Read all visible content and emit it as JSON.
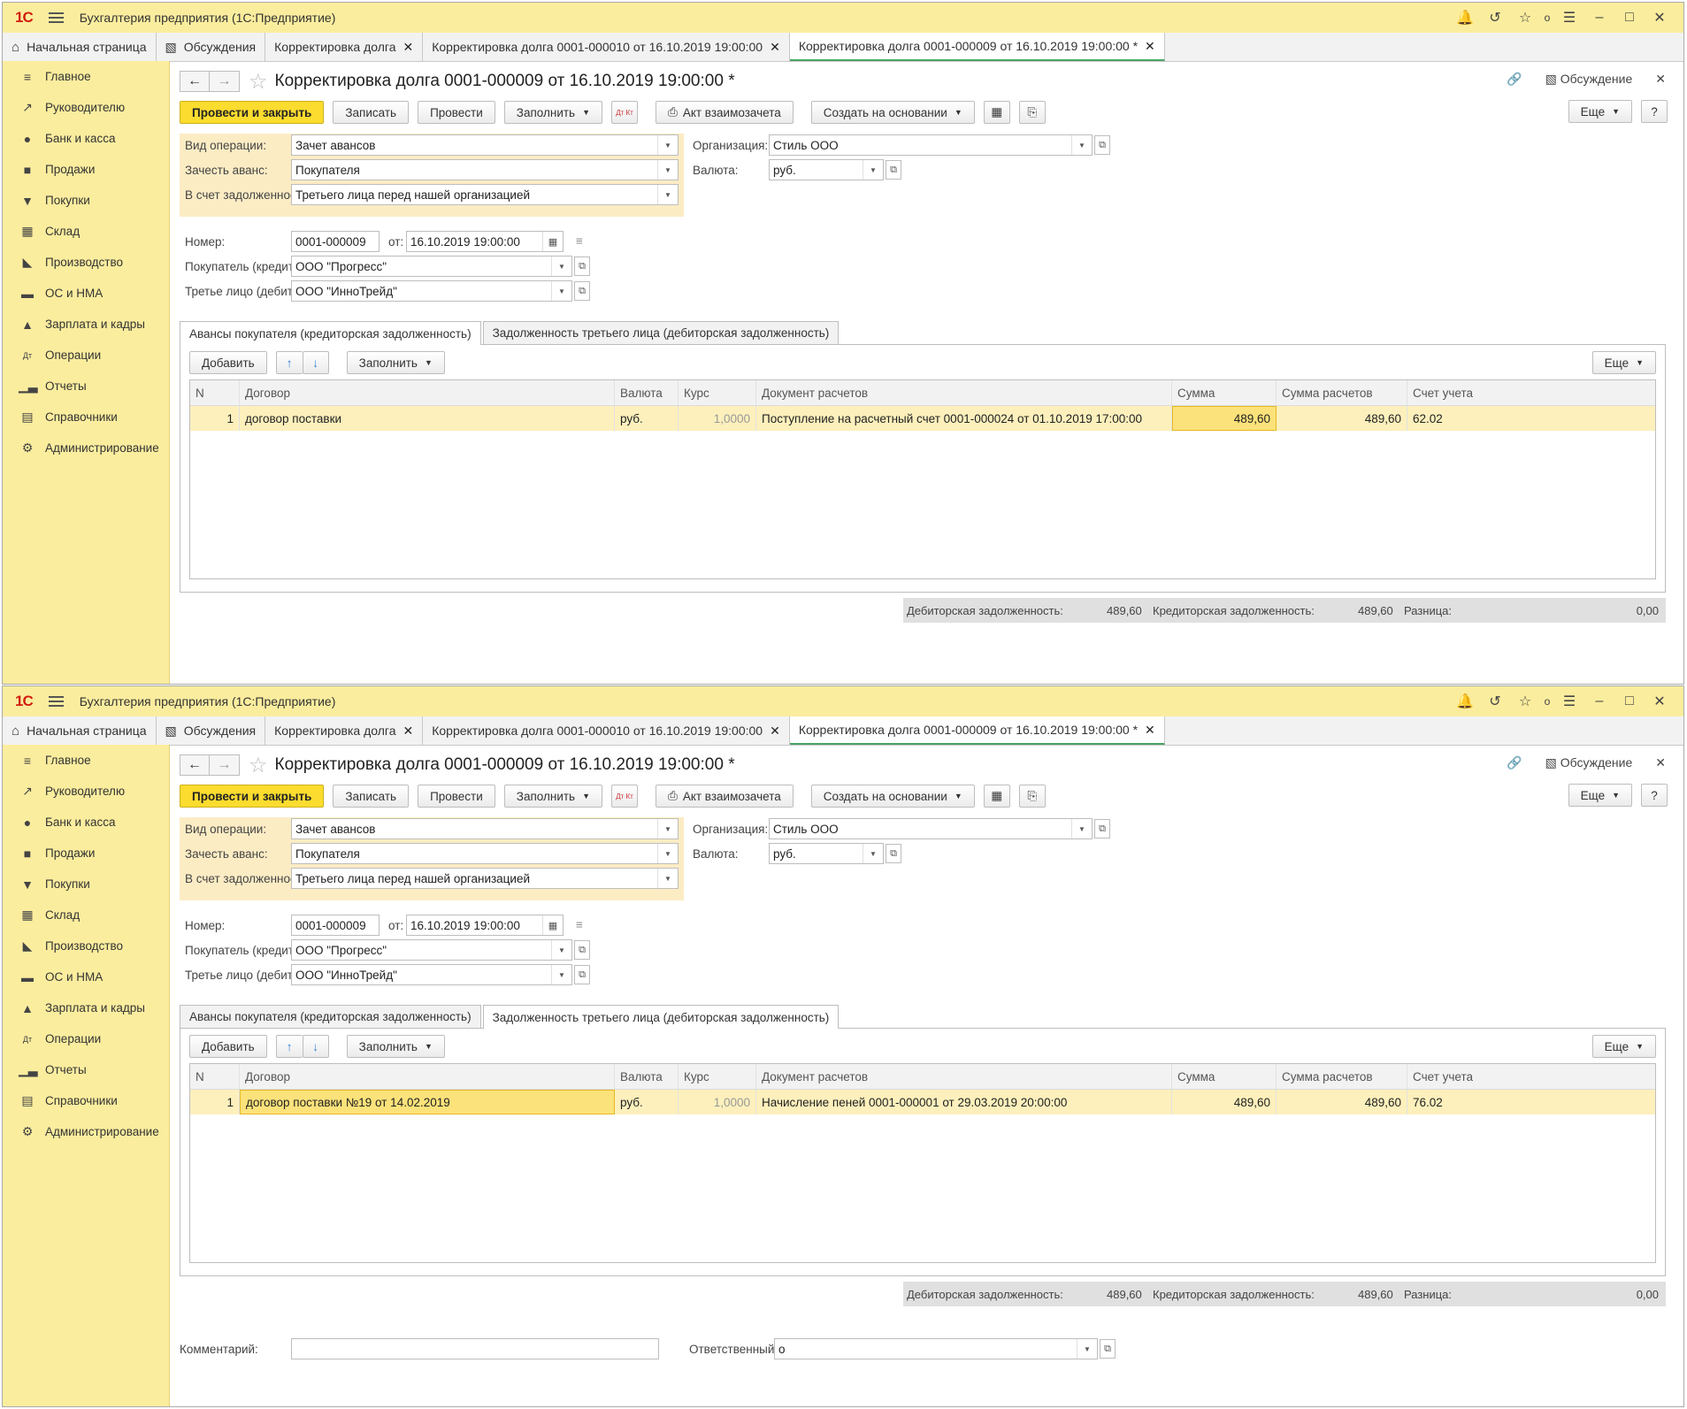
{
  "app": {
    "logo": "1С",
    "title": "Бухгалтерия предприятия  (1С:Предприятие)",
    "counter": "о"
  },
  "tabs": [
    {
      "label": "Начальная страница"
    },
    {
      "label": "Обсуждения"
    },
    {
      "label": "Корректировка долга"
    },
    {
      "label": "Корректировка долга 0001-000010 от 16.10.2019 19:00:00"
    },
    {
      "label": "Корректировка долга 0001-000009 от 16.10.2019 19:00:00 *"
    }
  ],
  "sidebar": [
    {
      "label": "Главное"
    },
    {
      "label": "Руководителю"
    },
    {
      "label": "Банк и касса"
    },
    {
      "label": "Продажи"
    },
    {
      "label": "Покупки"
    },
    {
      "label": "Склад"
    },
    {
      "label": "Производство"
    },
    {
      "label": "ОС и НМА"
    },
    {
      "label": "Зарплата и кадры"
    },
    {
      "label": "Операции"
    },
    {
      "label": "Отчеты"
    },
    {
      "label": "Справочники"
    },
    {
      "label": "Администрирование"
    }
  ],
  "doc": {
    "title": "Корректировка долга 0001-000009 от 16.10.2019 19:00:00 *",
    "discussion": "Обсуждение"
  },
  "toolbar": {
    "post_close": "Провести и закрыть",
    "save": "Записать",
    "post": "Провести",
    "fill": "Заполнить",
    "dtkt": "Дт Кт",
    "act": "Акт взаимозачета",
    "create_based": "Создать на основании",
    "more": "Еще",
    "help": "?"
  },
  "form": {
    "op_type_label": "Вид операции:",
    "op_type": "Зачет авансов",
    "advance_label": "Зачесть аванс:",
    "advance": "Покупателя",
    "debt_label": "В счет задолженности:",
    "debt": "Третьего лица перед нашей организацией",
    "org_label": "Организация:",
    "org": "Стиль ООО",
    "currency_label": "Валюта:",
    "currency": "руб.",
    "number_label": "Номер:",
    "number": "0001-000009",
    "from_label": "от:",
    "date": "16.10.2019 19:00:00",
    "buyer_label": "Покупатель (кредитор):",
    "buyer": "ООО \"Прогресс\"",
    "third_label": "Третье лицо (дебитор):",
    "third": "ООО \"ИнноТрейд\""
  },
  "doc_tabs": [
    {
      "label": "Авансы покупателя (кредиторская задолженность)"
    },
    {
      "label": "Задолженность третьего лица (дебиторская задолженность)"
    }
  ],
  "panel": {
    "add": "Добавить",
    "fill": "Заполнить",
    "more": "Еще"
  },
  "columns": [
    "N",
    "Договор",
    "Валюта",
    "Курс",
    "Документ расчетов",
    "Сумма",
    "Сумма расчетов",
    "Счет учета"
  ],
  "table1": [
    {
      "n": "1",
      "contract": "договор поставки",
      "currency": "руб.",
      "rate": "1,0000",
      "doc": "Поступление на расчетный счет 0001-000024 от 01.10.2019 17:00:00",
      "sum": "489,60",
      "calc_sum": "489,60",
      "account": "62.02"
    }
  ],
  "table2": [
    {
      "n": "1",
      "contract": "договор поставки №19 от 14.02.2019",
      "currency": "руб.",
      "rate": "1,0000",
      "doc": "Начисление пеней 0001-000001 от 29.03.2019 20:00:00",
      "sum": "489,60",
      "calc_sum": "489,60",
      "account": "76.02"
    }
  ],
  "totals": {
    "debit_label": "Дебиторская задолженность:",
    "debit": "489,60",
    "credit_label": "Кредиторская задолженность:",
    "credit": "489,60",
    "diff_label": "Разница:",
    "diff": "0,00"
  },
  "footer": {
    "comment_label": "Комментарий:",
    "comment": "",
    "responsible_label": "Ответственный:",
    "responsible": "о"
  },
  "colors": {
    "accent": "#fbdc2f",
    "sidebar": "#fbed9e",
    "gold_block": "#fcecc4",
    "row_selected": "#fdf0bc",
    "brand_red": "#d21f0f"
  }
}
